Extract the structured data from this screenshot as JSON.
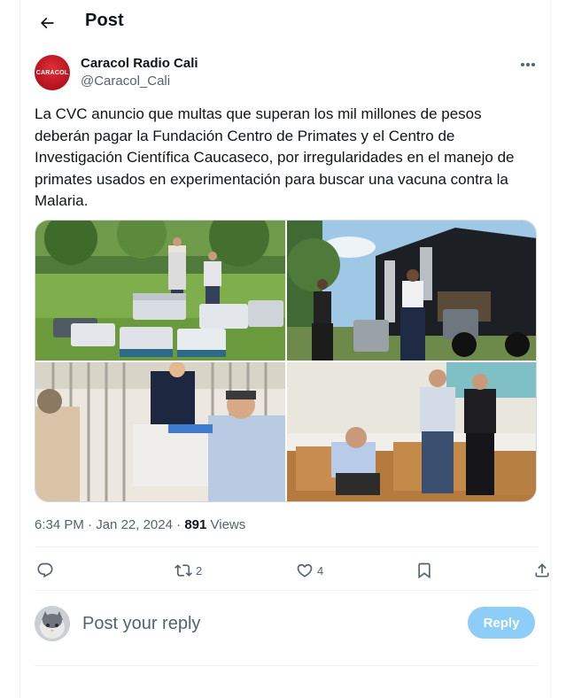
{
  "header": {
    "title": "Post"
  },
  "author": {
    "name": "Caracol Radio Cali",
    "handle": "@Caracol_Cali",
    "avatar_text": "CARACOL",
    "avatar_color": "#c4161f"
  },
  "tweet": {
    "text": "La CVC anuncio que multas que superan los mil millones de pesos deberán pagar la Fundación Centro de Primates y el Centro de Investigación Científica Caucaseco, por irregularidades en el manejo de primates usados en experimentación para buscar una vacuna contra la Malaria."
  },
  "media": [
    {
      "description": "photo-officials-with-animal-crates-on-lawn"
    },
    {
      "description": "photo-workers-unloading-crates-from-truck"
    },
    {
      "description": "photo-inspector-examining-primate-cage"
    },
    {
      "description": "photo-officials-inspecting-wooden-boxes"
    }
  ],
  "meta": {
    "time": "6:34 PM",
    "separator": "·",
    "date": "Jan 22, 2024",
    "views_count": "891",
    "views_label": "Views"
  },
  "actions": {
    "replies": "",
    "reposts": "2",
    "likes": "4"
  },
  "reply_box": {
    "placeholder": "Post your reply",
    "button_label": "Reply"
  },
  "colors": {
    "accent": "#1d9bf0",
    "reply_button_disabled": "#8ecdf8",
    "secondary_text": "#536471"
  }
}
